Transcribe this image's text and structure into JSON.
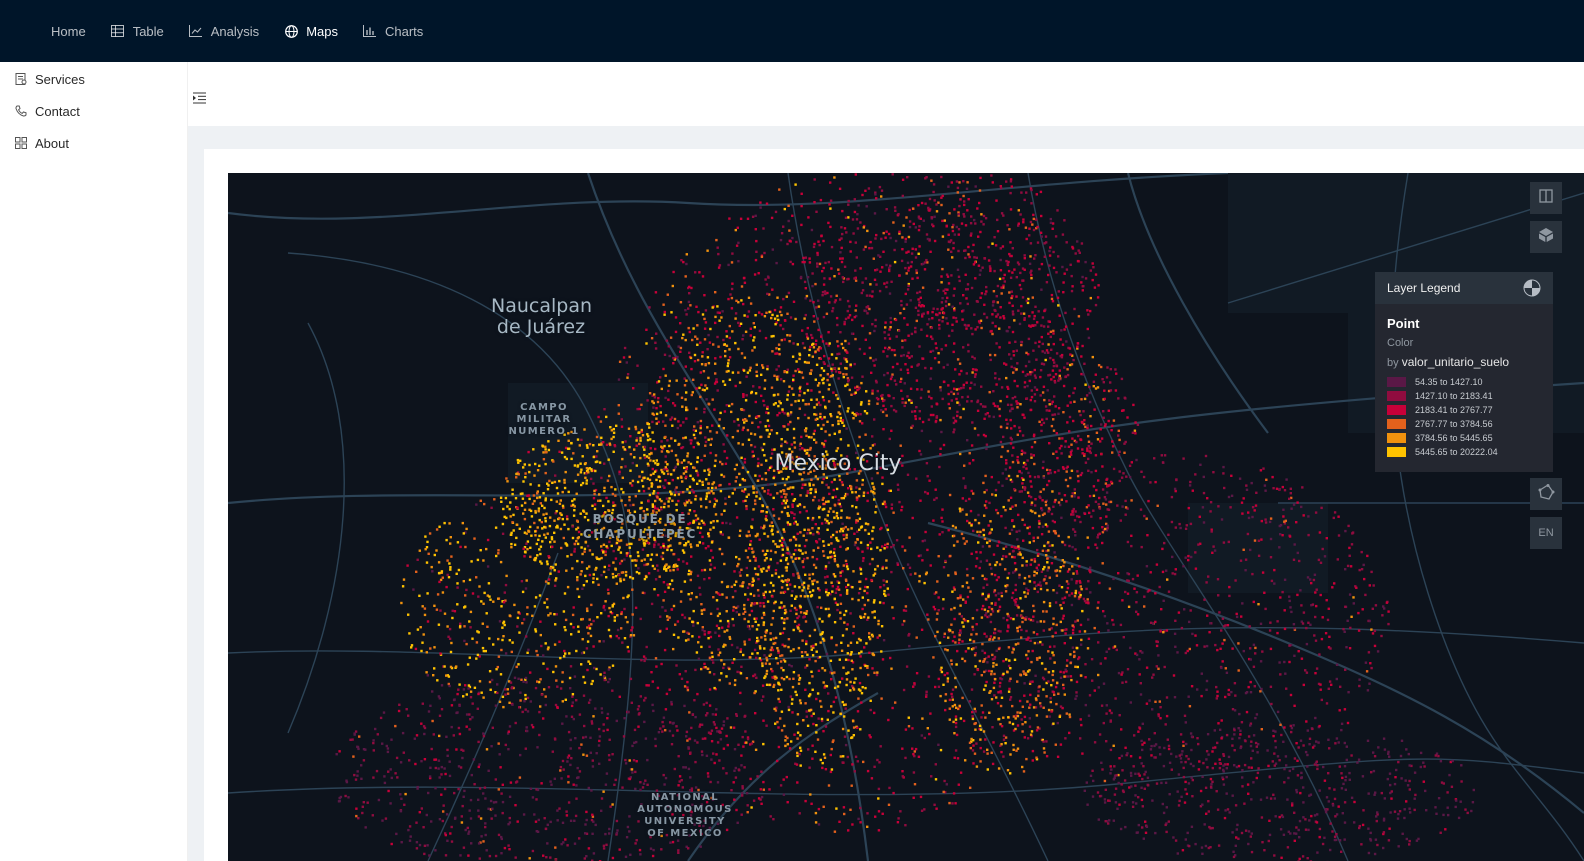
{
  "nav": {
    "items": [
      {
        "label": "Home",
        "icon": "none",
        "active": false
      },
      {
        "label": "Table",
        "icon": "table-icon",
        "active": false
      },
      {
        "label": "Analysis",
        "icon": "line-chart-icon",
        "active": false
      },
      {
        "label": "Maps",
        "icon": "globe-icon",
        "active": true
      },
      {
        "label": "Charts",
        "icon": "bar-chart-icon",
        "active": false
      }
    ]
  },
  "sidebar": {
    "items": [
      {
        "label": "Services",
        "icon": "services-icon"
      },
      {
        "label": "Contact",
        "icon": "phone-icon"
      },
      {
        "label": "About",
        "icon": "about-icon"
      }
    ]
  },
  "map": {
    "labels": {
      "naucalpan": "Naucalpan\nde Juárez",
      "campo": "CAMPO\nMILITAR\nNUMERO 1",
      "mexico_city": "Mexico City",
      "bosque": "BOSQUE DE\nCHAPULTEPEC",
      "unam": "NATIONAL\nAUTONOMOUS\nUNIVERSITY\nOF MEXICO"
    },
    "lang_button": "EN"
  },
  "legend": {
    "title": "Layer Legend",
    "layer": "Point",
    "property": "Color",
    "by_prefix": "by",
    "field": "valor_unitario_suelo",
    "ranges": [
      {
        "label": "54.35 to 1427.10",
        "color": "#5a1846"
      },
      {
        "label": "1427.10 to 2183.41",
        "color": "#900c3f"
      },
      {
        "label": "2183.41 to 2767.77",
        "color": "#c70039"
      },
      {
        "label": "2767.77 to 3784.56",
        "color": "#e3611c"
      },
      {
        "label": "3784.56 to 5445.65",
        "color": "#f1920e"
      },
      {
        "label": "5445.65 to 20222.04",
        "color": "#ffc300"
      }
    ]
  },
  "colors": {
    "nav_bg": "#001529",
    "map_bg": "#0d131c",
    "road": "#2c4356"
  }
}
